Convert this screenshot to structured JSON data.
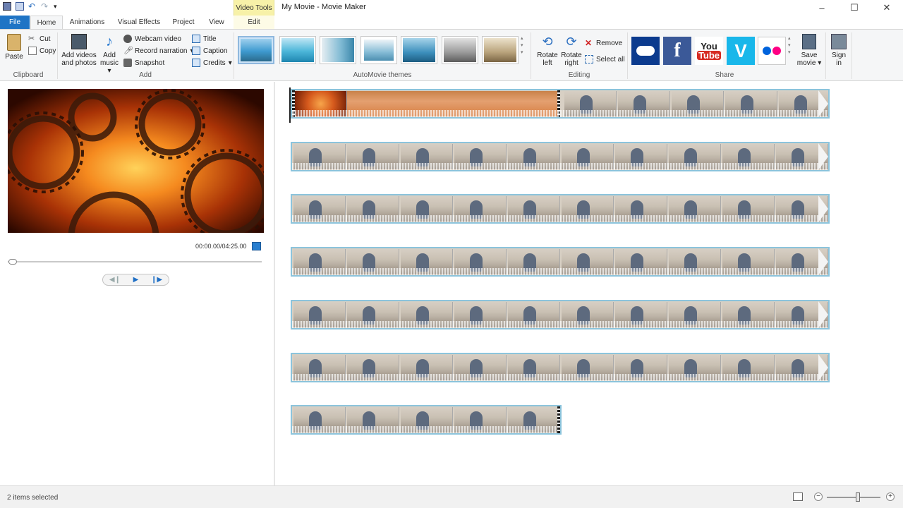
{
  "window": {
    "title": "My Movie - Movie Maker",
    "controls": [
      "–",
      "☐",
      "✕"
    ]
  },
  "contextual_tab": {
    "group": "Video Tools",
    "tab": "Edit"
  },
  "tabs": [
    "File",
    "Home",
    "Animations",
    "Visual Effects",
    "Project",
    "View"
  ],
  "active_tab": "Home",
  "ribbon": {
    "clipboard": {
      "label": "Clipboard",
      "paste": "Paste",
      "cut": "Cut",
      "copy": "Copy"
    },
    "add": {
      "label": "Add",
      "add_videos_line1": "Add videos",
      "add_videos_line2": "and photos",
      "add_music_line1": "Add",
      "add_music_line2": "music",
      "webcam": "Webcam video",
      "narration": "Record narration",
      "snapshot": "Snapshot",
      "title": "Title",
      "caption": "Caption",
      "credits": "Credits"
    },
    "themes": {
      "label": "AutoMovie themes",
      "count": 7
    },
    "editing": {
      "label": "Editing",
      "rotate_left_1": "Rotate",
      "rotate_left_2": "left",
      "rotate_right_1": "Rotate",
      "rotate_right_2": "right",
      "remove": "Remove",
      "select_all": "Select all"
    },
    "share": {
      "label": "Share",
      "services": [
        "onedrive",
        "facebook",
        "youtube",
        "vimeo",
        "flickr"
      ],
      "youtube_text_1": "You",
      "youtube_text_2": "Tube",
      "save_movie_1": "Save",
      "save_movie_2": "movie"
    },
    "sign_in_1": "Sign",
    "sign_in_2": "in"
  },
  "preview": {
    "time": "00:00.00/04:25.00",
    "seek_progress": 0
  },
  "storyboard": {
    "rows": 7,
    "frames_per_row": 10,
    "last_row_frames": 5
  },
  "status": {
    "text": "2 items selected",
    "zoom_level": 0.55
  },
  "colors": {
    "file_tab": "#1f74c5",
    "clip_border": "#8cc4dc",
    "context_tab": "#f7f1a8"
  }
}
